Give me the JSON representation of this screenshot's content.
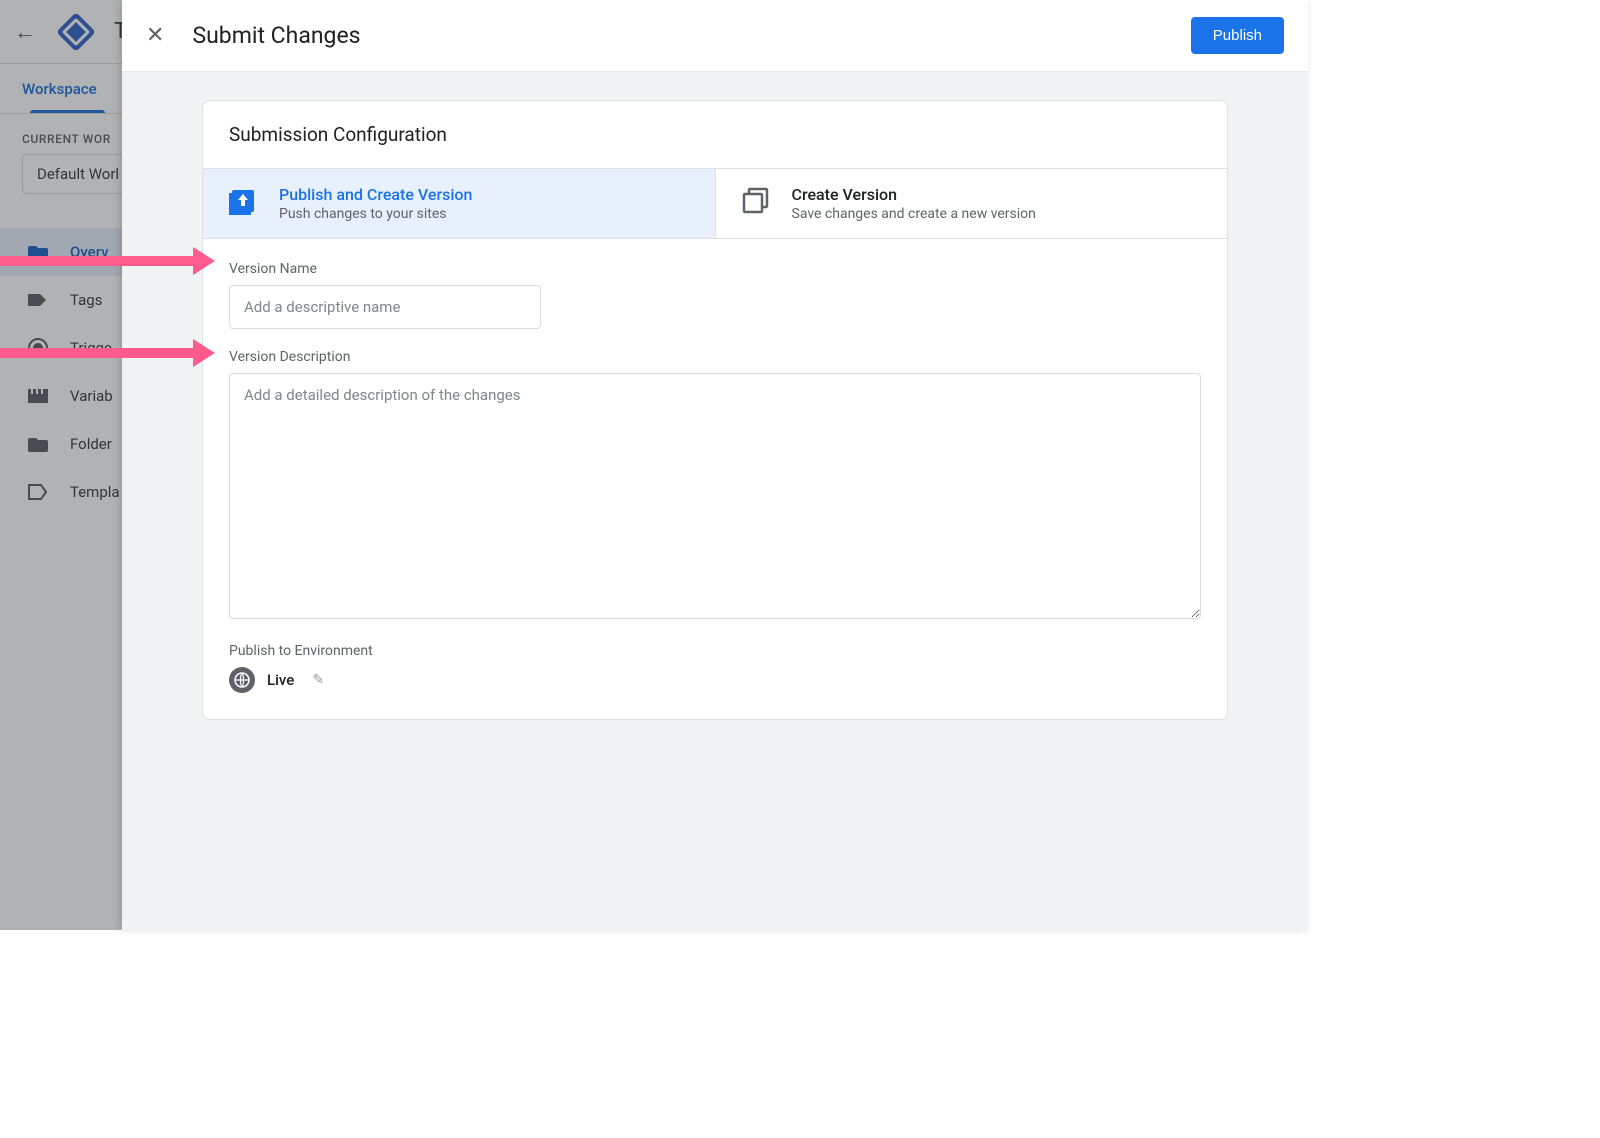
{
  "background": {
    "page_letter": "T",
    "tab_workspace": "Workspace",
    "ws_label": "CURRENT WOR",
    "ws_value": "Default Worl",
    "nav": {
      "overview": "Overv",
      "tags": "Tags",
      "triggers": "Trigge",
      "variables": "Variab",
      "folders": "Folder",
      "templates": "Templa"
    }
  },
  "modal": {
    "title": "Submit Changes",
    "publish_btn": "Publish",
    "config_heading": "Submission Configuration",
    "options": {
      "publish": {
        "title": "Publish and Create Version",
        "desc": "Push changes to your sites"
      },
      "create": {
        "title": "Create Version",
        "desc": "Save changes and create a new version"
      }
    },
    "version_name_label": "Version Name",
    "version_name_placeholder": "Add a descriptive name",
    "version_desc_label": "Version Description",
    "version_desc_placeholder": "Add a detailed description of the changes",
    "env_label": "Publish to Environment",
    "env_value": "Live"
  }
}
